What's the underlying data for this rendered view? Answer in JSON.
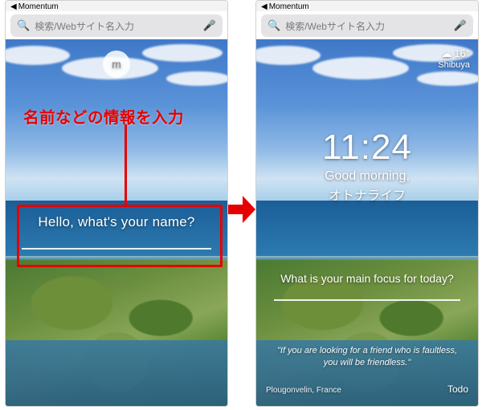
{
  "back_app": {
    "label": "Momentum",
    "glyph": "◀"
  },
  "search": {
    "placeholder": "検索/Webサイト名入力",
    "mag_glyph": "🔍",
    "mic_glyph": "🎤"
  },
  "annotation": {
    "text": "名前などの情報を入力"
  },
  "left": {
    "logo_glyph": "m",
    "prompt": "Hello, what's your name?"
  },
  "right": {
    "weather": {
      "icon_glyph": "☁",
      "temp": "16°",
      "loc": "Shibuya"
    },
    "time": "11:24",
    "greeting": "Good morning,",
    "name": "オトナライフ",
    "focus_question": "What is your main focus for today?",
    "quote": "\"If you are looking for a friend who is faultless, you will be friendless.\"",
    "location": "Plougonvelin, France",
    "todo_label": "Todo"
  }
}
